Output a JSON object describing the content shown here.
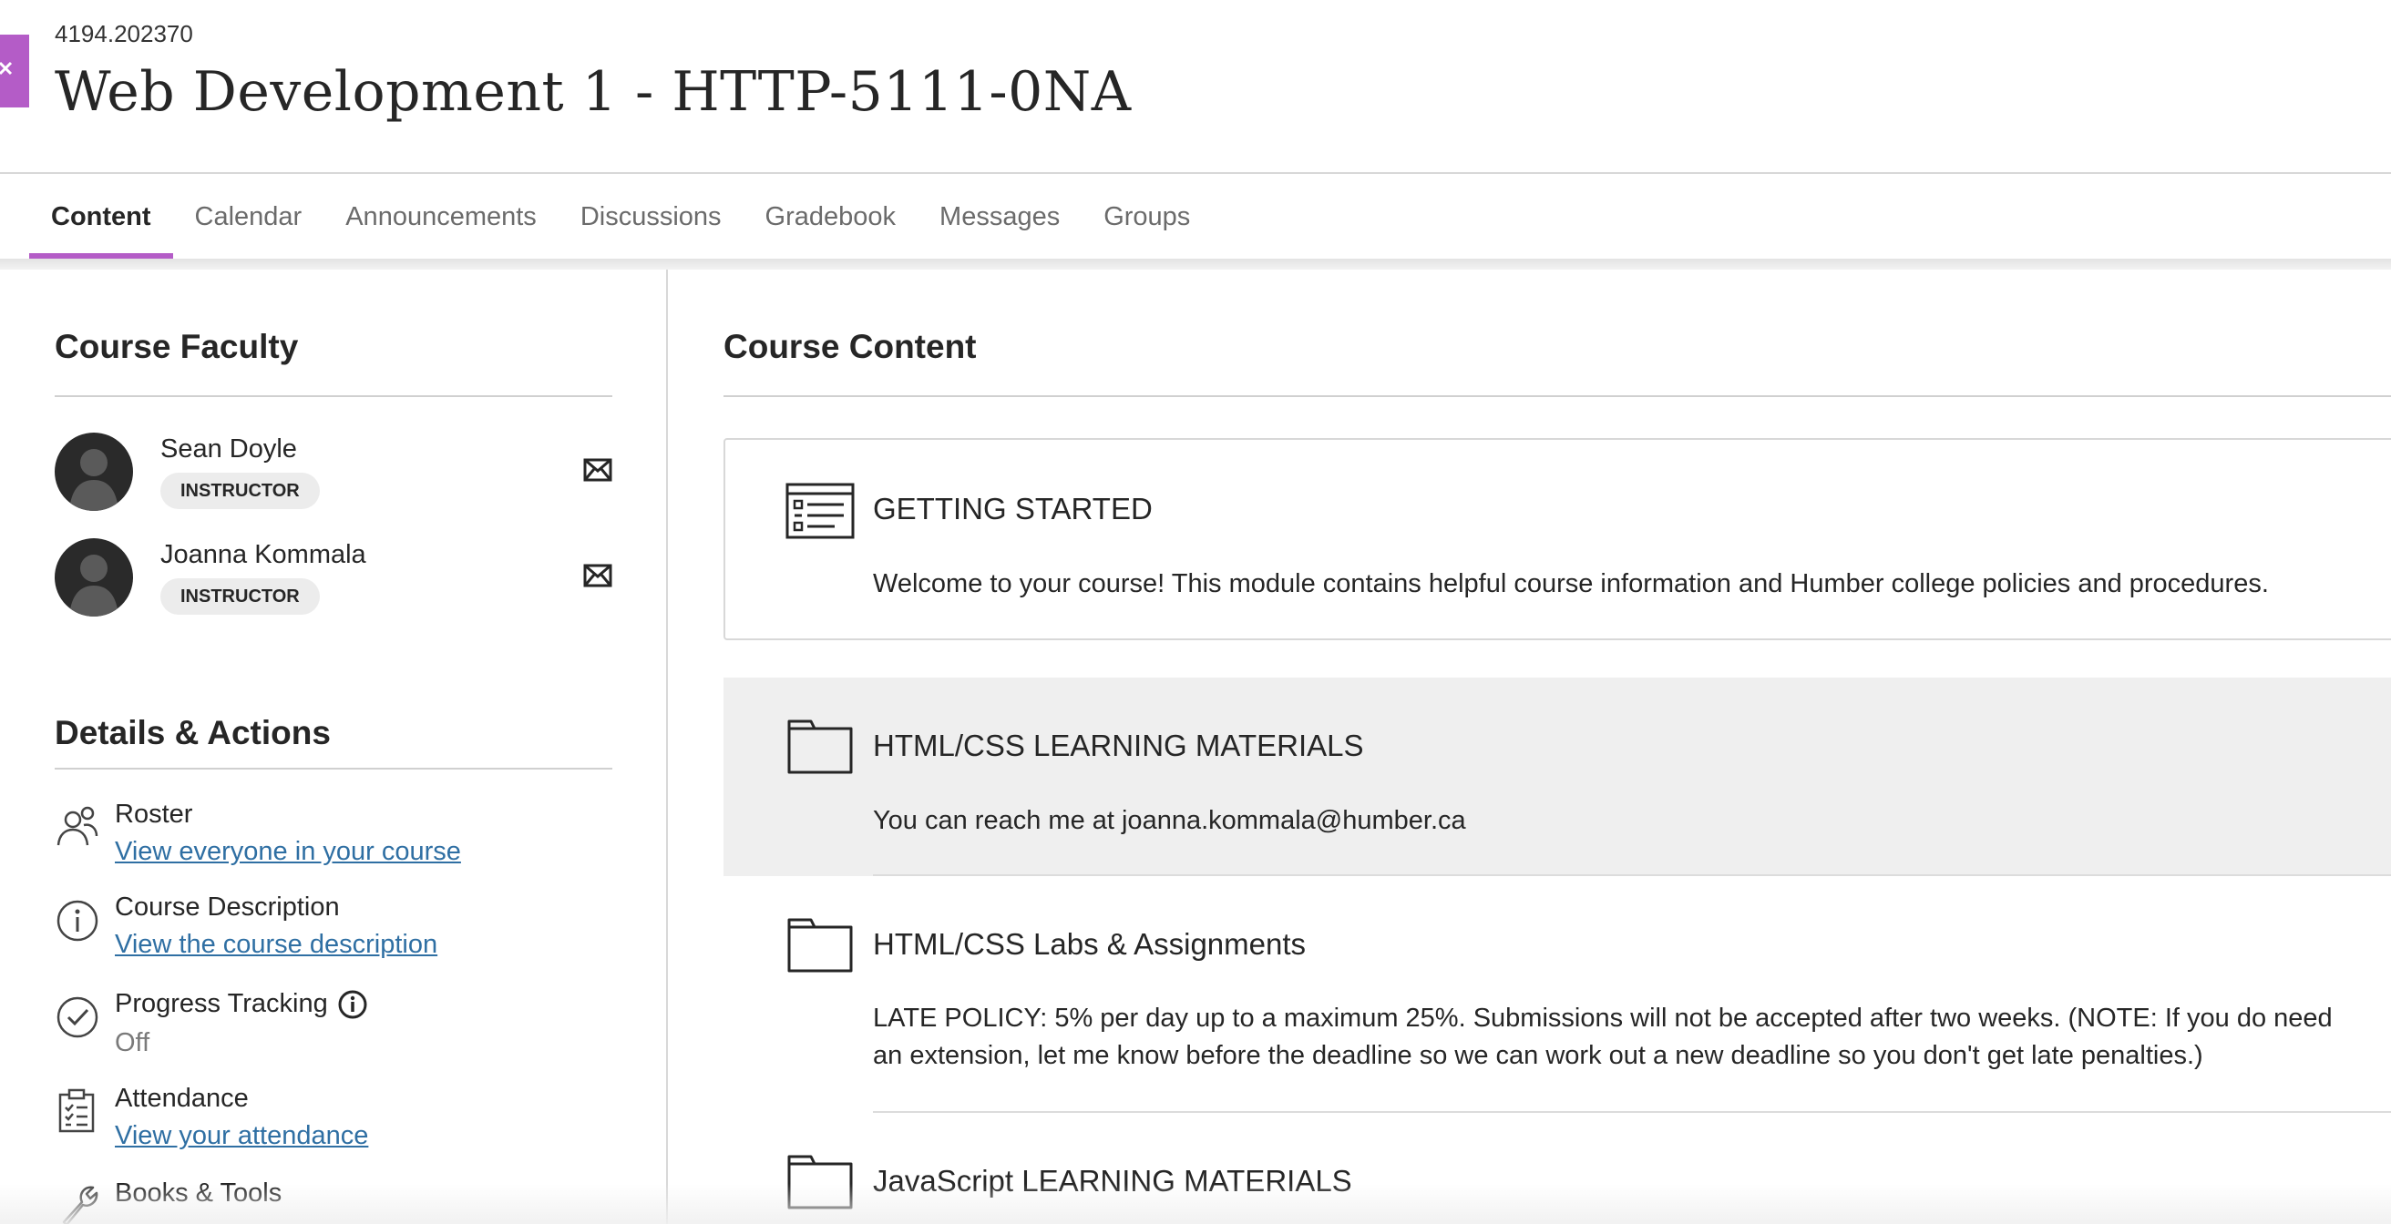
{
  "header": {
    "course_id": "4194.202370",
    "course_title": "Web Development 1 - HTTP-5111-0NA"
  },
  "tabs": [
    {
      "label": "Content",
      "active": true
    },
    {
      "label": "Calendar",
      "active": false
    },
    {
      "label": "Announcements",
      "active": false
    },
    {
      "label": "Discussions",
      "active": false
    },
    {
      "label": "Gradebook",
      "active": false
    },
    {
      "label": "Messages",
      "active": false
    },
    {
      "label": "Groups",
      "active": false
    }
  ],
  "faculty": {
    "title": "Course Faculty",
    "members": [
      {
        "name": "Sean Doyle",
        "role": "INSTRUCTOR"
      },
      {
        "name": "Joanna Kommala",
        "role": "INSTRUCTOR"
      }
    ]
  },
  "details": {
    "title": "Details & Actions",
    "items": [
      {
        "label": "Roster",
        "link": "View everyone in your course",
        "icon": "roster-icon"
      },
      {
        "label": "Course Description",
        "link": "View the course description",
        "icon": "info-icon"
      },
      {
        "label": "Progress Tracking",
        "value": "Off",
        "icon": "check-circle-icon"
      },
      {
        "label": "Attendance",
        "link": "View your attendance",
        "icon": "clipboard-icon"
      },
      {
        "label": "Books & Tools",
        "icon": "wrench-icon"
      }
    ]
  },
  "content": {
    "title": "Course Content",
    "items": [
      {
        "title": "GETTING STARTED",
        "description": "Welcome to your course! This module contains helpful course information and Humber college policies and procedures.",
        "icon": "learning-module-icon"
      },
      {
        "title": "HTML/CSS LEARNING MATERIALS",
        "description": "You can reach me at joanna.kommala@humber.ca",
        "icon": "folder-icon"
      },
      {
        "title": "HTML/CSS Labs & Assignments",
        "description": "LATE POLICY: 5% per day up to a maximum 25%. Submissions will not be accepted after two weeks. (NOTE: If you do need an extension, let me know before the deadline so we can work out a new deadline so you don't get late penalties.)",
        "icon": "folder-icon"
      },
      {
        "title": "JavaScript LEARNING MATERIALS",
        "icon": "folder-icon"
      }
    ]
  },
  "colors": {
    "accent": "#b45cc7",
    "link": "#2f6fa3",
    "highlight_row": "#efefef"
  }
}
